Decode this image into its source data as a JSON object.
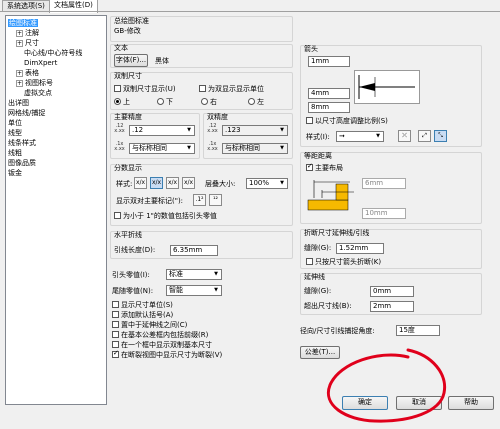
{
  "tabs": [
    "系统选项(S)",
    "文档属性(D)"
  ],
  "tree": [
    {
      "label": "绘图标准",
      "indent": 0,
      "exp": null
    },
    {
      "label": "注解",
      "indent": 1,
      "exp": "+"
    },
    {
      "label": "尺寸",
      "indent": 1,
      "exp": "+"
    },
    {
      "label": "中心线/中心符号线",
      "indent": 2,
      "exp": null
    },
    {
      "label": "DimXpert",
      "indent": 2,
      "exp": null
    },
    {
      "label": "表格",
      "indent": 1,
      "exp": "+"
    },
    {
      "label": "视图标号",
      "indent": 1,
      "exp": "+"
    },
    {
      "label": "虚拟交点",
      "indent": 2,
      "exp": null
    },
    {
      "label": "出详图",
      "indent": 0,
      "exp": null
    },
    {
      "label": "网格线/捕捉",
      "indent": 0,
      "exp": null
    },
    {
      "label": "单位",
      "indent": 0,
      "exp": null
    },
    {
      "label": "线型",
      "indent": 0,
      "exp": null
    },
    {
      "label": "线条样式",
      "indent": 0,
      "exp": null
    },
    {
      "label": "线粗",
      "indent": 0,
      "exp": null
    },
    {
      "label": "图像品质",
      "indent": 0,
      "exp": null
    },
    {
      "label": "钣金",
      "indent": 0,
      "exp": null
    }
  ],
  "overall": {
    "group_label": "总绘图标准",
    "value": "GB-修改"
  },
  "text": {
    "group_label": "文本",
    "font_button": "字体(F)...",
    "font_name": "黑体"
  },
  "dual": {
    "group_label": "双制尺寸",
    "show_dual": "双制尺寸显示(U)",
    "show_dual_units": "为双显示显示单位",
    "positions": [
      "上",
      "下",
      "右",
      "左"
    ],
    "selected_position": "上"
  },
  "primary_precision": {
    "group_label": "主要精度",
    "value": ".12",
    "tolerance": "与标称相同"
  },
  "dual_precision": {
    "group_label": "双精度",
    "value": ".123",
    "tolerance": "与标称相同"
  },
  "fraction": {
    "group_label": "分数显示",
    "style_label": "样式:",
    "stack_label": "层叠大小:",
    "stack_value": "100%",
    "dual_mark_label": "显示双对主要标记(\"):",
    "zero_checkbox": "为小于 1\"的数值包括引头零值",
    "style_buttons": [
      "x/x",
      "x/x",
      "x/x",
      "x/x"
    ]
  },
  "horizontal_break": {
    "group_label": "水平折线",
    "length_label": "引线长度(D):",
    "length_value": "6.35mm"
  },
  "leading_zero": {
    "label": "引头零值(I):",
    "value": "标准"
  },
  "trailing_zero": {
    "label": "尾随零值(N):",
    "value": "智能"
  },
  "options": [
    {
      "label": "显示尺寸单位(S)",
      "checked": false
    },
    {
      "label": "添加默认括号(A)",
      "checked": false
    },
    {
      "label": "置中于延伸线之间(C)",
      "checked": false
    },
    {
      "label": "在基本公差框内包括前缀(R)",
      "checked": false
    },
    {
      "label": "在一个框中显示双制基本尺寸",
      "checked": false
    },
    {
      "label": "在断裂视图中显示尺寸为断裂(V)",
      "checked": true
    }
  ],
  "arrows": {
    "group_label": "箭头",
    "fields": [
      "1mm",
      "4mm",
      "8mm"
    ],
    "scale_checkbox": "以尺寸高度调整比例(S)",
    "style_label": "样式(I):"
  },
  "offset": {
    "group_label": "等距距离",
    "main_layout": "主要布局",
    "fields": [
      "6mm",
      "10mm"
    ]
  },
  "break_ext": {
    "group_label": "折断尺寸延伸线/引线",
    "gap_label": "缝隙(G):",
    "gap_value": "1.52mm",
    "only_arrow": "只按尺寸箭头折断(K)"
  },
  "ext_lines": {
    "group_label": "延伸线",
    "gap_label": "缝隙(G):",
    "gap_value": "0mm",
    "beyond_label": "超出尺寸线(B):",
    "beyond_value": "2mm"
  },
  "radial": {
    "label": "径向/尺寸引线捕捉角度:",
    "value": "15度"
  },
  "tolerance_button": "公差(T)...",
  "footer": {
    "ok": "确定",
    "cancel": "取消",
    "help": "帮助"
  },
  "colors": {
    "accent": "#3399ff",
    "annotation": "#e0001b"
  }
}
